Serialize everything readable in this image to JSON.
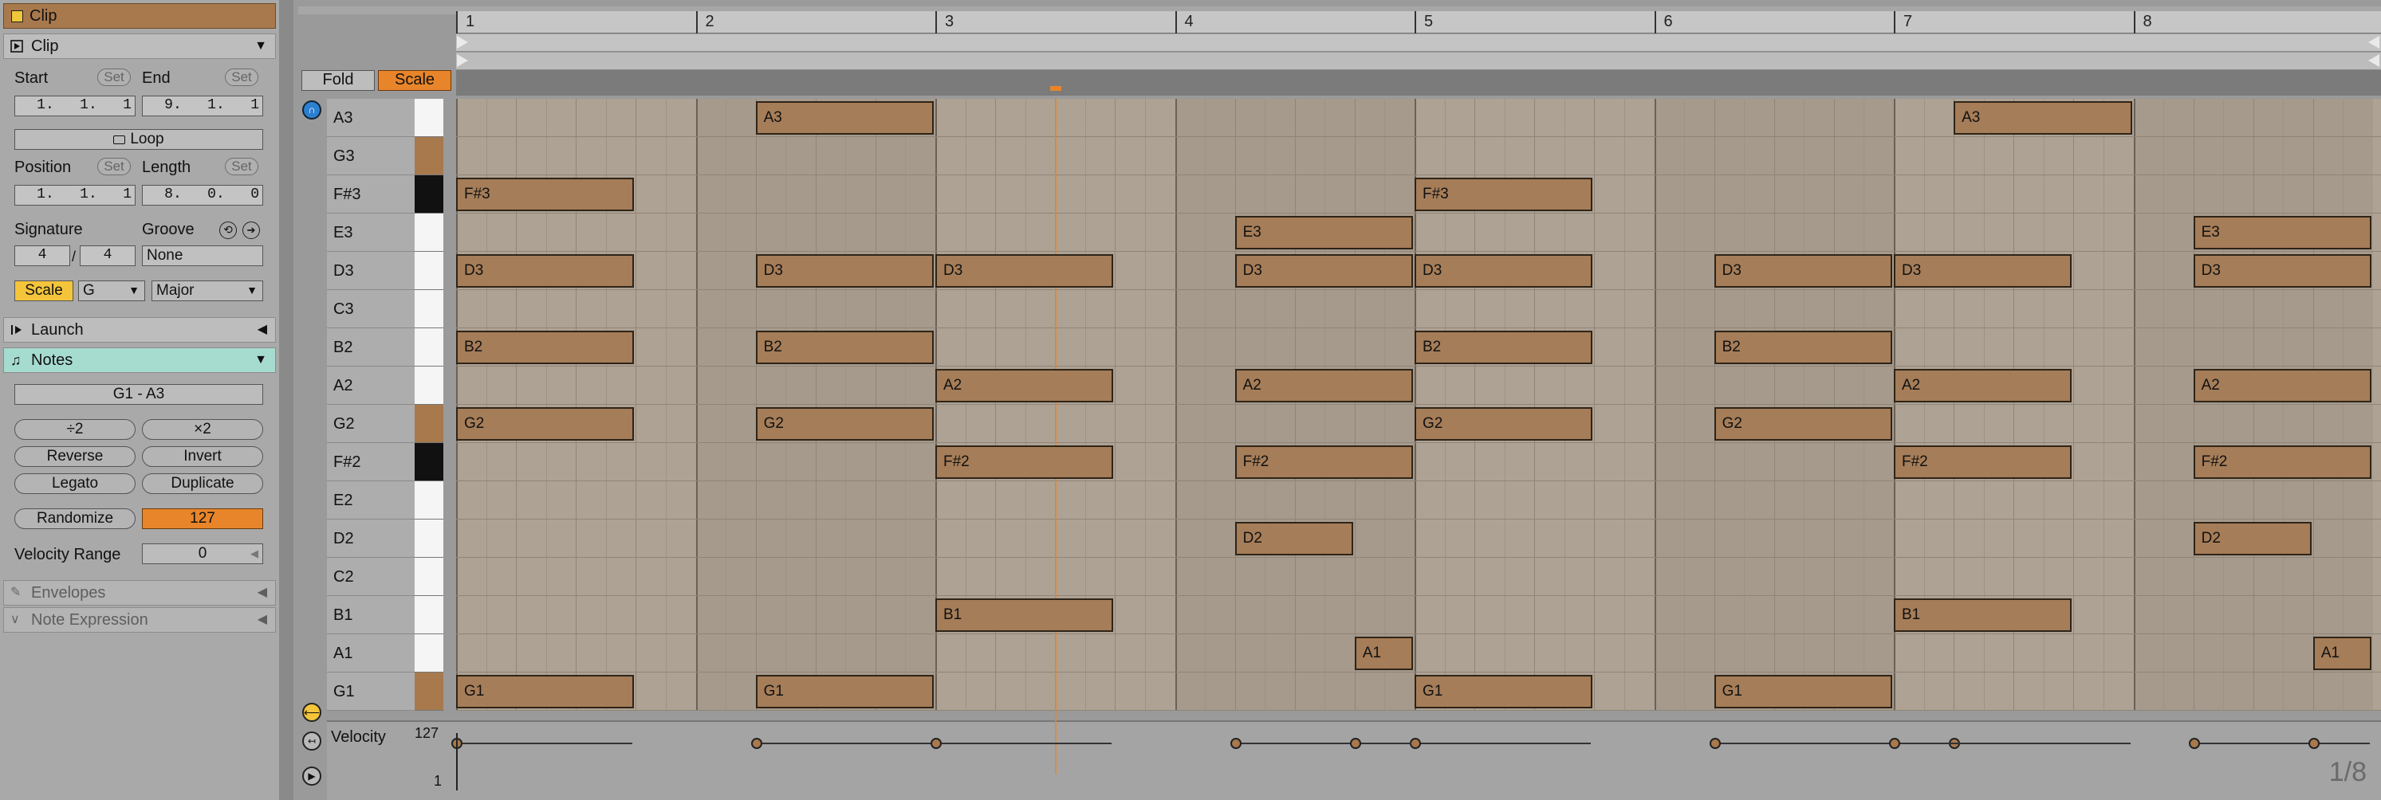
{
  "clip_title": "Clip",
  "clip_section": "Clip",
  "start_label": "Start",
  "end_label": "End",
  "set_label": "Set",
  "start_value": "1.   1.   1",
  "end_value": "9.   1.   1",
  "loop_label": "Loop",
  "position_label": "Position",
  "length_label": "Length",
  "position_value": "1.   1.   1",
  "length_value": "8.   0.   0",
  "signature_label": "Signature",
  "groove_label": "Groove",
  "sig_num": "4",
  "sig_sep": "/",
  "sig_den": "4",
  "groove_value": "None",
  "scale_label": "Scale",
  "scale_root": "G",
  "scale_mode": "Major",
  "launch_label": "Launch",
  "notes_label": "Notes",
  "note_range": "G1 - A3",
  "half_label": "÷2",
  "double_label": "×2",
  "reverse_label": "Reverse",
  "invert_label": "Invert",
  "legato_label": "Legato",
  "duplicate_label": "Duplicate",
  "randomize_label": "Randomize",
  "randomize_value": "127",
  "velocity_range_label": "Velocity Range",
  "velocity_range_value": "0",
  "envelopes_label": "Envelopes",
  "note_expression_label": "Note Expression",
  "fold_label": "Fold",
  "editor_scale_label": "Scale",
  "bars": [
    "1",
    "2",
    "3",
    "4",
    "5",
    "6",
    "7",
    "8"
  ],
  "velocity_label": "Velocity",
  "velocity_max": "127",
  "velocity_min": "1",
  "grid_label": "1/8",
  "colors": {
    "note": "#a57d58",
    "scale_active": "#e8852a",
    "scale_yellow": "#f4c53b",
    "notes_header": "#a6dcd0"
  },
  "keys": [
    {
      "name": "A3",
      "black": false,
      "in_scale": true
    },
    {
      "name": "G3",
      "black": false,
      "root": true
    },
    {
      "name": "F#3",
      "black": true
    },
    {
      "name": "E3",
      "black": false
    },
    {
      "name": "D3",
      "black": false
    },
    {
      "name": "C3",
      "black": false
    },
    {
      "name": "B2",
      "black": false
    },
    {
      "name": "A2",
      "black": false
    },
    {
      "name": "G2",
      "black": false,
      "root": true
    },
    {
      "name": "F#2",
      "black": true
    },
    {
      "name": "E2",
      "black": false
    },
    {
      "name": "D2",
      "black": false
    },
    {
      "name": "C2",
      "black": false
    },
    {
      "name": "B1",
      "black": false
    },
    {
      "name": "A1",
      "black": false
    },
    {
      "name": "G1",
      "black": false,
      "root": true
    }
  ],
  "notes": [
    {
      "pitch": "A3",
      "start": 1.25,
      "len": 0.75
    },
    {
      "pitch": "A3",
      "start": 6.25,
      "len": 0.75
    },
    {
      "pitch": "F#3",
      "start": 0,
      "len": 0.75
    },
    {
      "pitch": "F#3",
      "start": 4,
      "len": 0.75
    },
    {
      "pitch": "E3",
      "start": 3.25,
      "len": 0.75
    },
    {
      "pitch": "E3",
      "start": 7.25,
      "len": 0.75
    },
    {
      "pitch": "D3",
      "start": 0,
      "len": 0.75
    },
    {
      "pitch": "D3",
      "start": 1.25,
      "len": 0.75
    },
    {
      "pitch": "D3",
      "start": 2,
      "len": 0.75
    },
    {
      "pitch": "D3",
      "start": 3.25,
      "len": 0.75
    },
    {
      "pitch": "D3",
      "start": 4,
      "len": 0.75
    },
    {
      "pitch": "D3",
      "start": 5.25,
      "len": 0.75
    },
    {
      "pitch": "D3",
      "start": 6,
      "len": 0.75
    },
    {
      "pitch": "D3",
      "start": 7.25,
      "len": 0.75
    },
    {
      "pitch": "B2",
      "start": 0,
      "len": 0.75
    },
    {
      "pitch": "B2",
      "start": 1.25,
      "len": 0.75
    },
    {
      "pitch": "B2",
      "start": 4,
      "len": 0.75
    },
    {
      "pitch": "B2",
      "start": 5.25,
      "len": 0.75
    },
    {
      "pitch": "A2",
      "start": 2,
      "len": 0.75
    },
    {
      "pitch": "A2",
      "start": 3.25,
      "len": 0.75
    },
    {
      "pitch": "A2",
      "start": 6,
      "len": 0.75
    },
    {
      "pitch": "A2",
      "start": 7.25,
      "len": 0.75
    },
    {
      "pitch": "G2",
      "start": 0,
      "len": 0.75
    },
    {
      "pitch": "G2",
      "start": 1.25,
      "len": 0.75
    },
    {
      "pitch": "G2",
      "start": 4,
      "len": 0.75
    },
    {
      "pitch": "G2",
      "start": 5.25,
      "len": 0.75
    },
    {
      "pitch": "F#2",
      "start": 2,
      "len": 0.75
    },
    {
      "pitch": "F#2",
      "start": 3.25,
      "len": 0.75
    },
    {
      "pitch": "F#2",
      "start": 6,
      "len": 0.75
    },
    {
      "pitch": "F#2",
      "start": 7.25,
      "len": 0.75
    },
    {
      "pitch": "D2",
      "start": 3.25,
      "len": 0.5
    },
    {
      "pitch": "D2",
      "start": 7.25,
      "len": 0.5
    },
    {
      "pitch": "B1",
      "start": 2,
      "len": 0.75
    },
    {
      "pitch": "B1",
      "start": 6,
      "len": 0.75
    },
    {
      "pitch": "A1",
      "start": 3.75,
      "len": 0.25
    },
    {
      "pitch": "A1",
      "start": 7.75,
      "len": 0.25
    },
    {
      "pitch": "G1",
      "start": 0,
      "len": 0.75
    },
    {
      "pitch": "G1",
      "start": 1.25,
      "len": 0.75
    },
    {
      "pitch": "G1",
      "start": 4,
      "len": 0.75
    },
    {
      "pitch": "G1",
      "start": 5.25,
      "len": 0.75
    }
  ]
}
